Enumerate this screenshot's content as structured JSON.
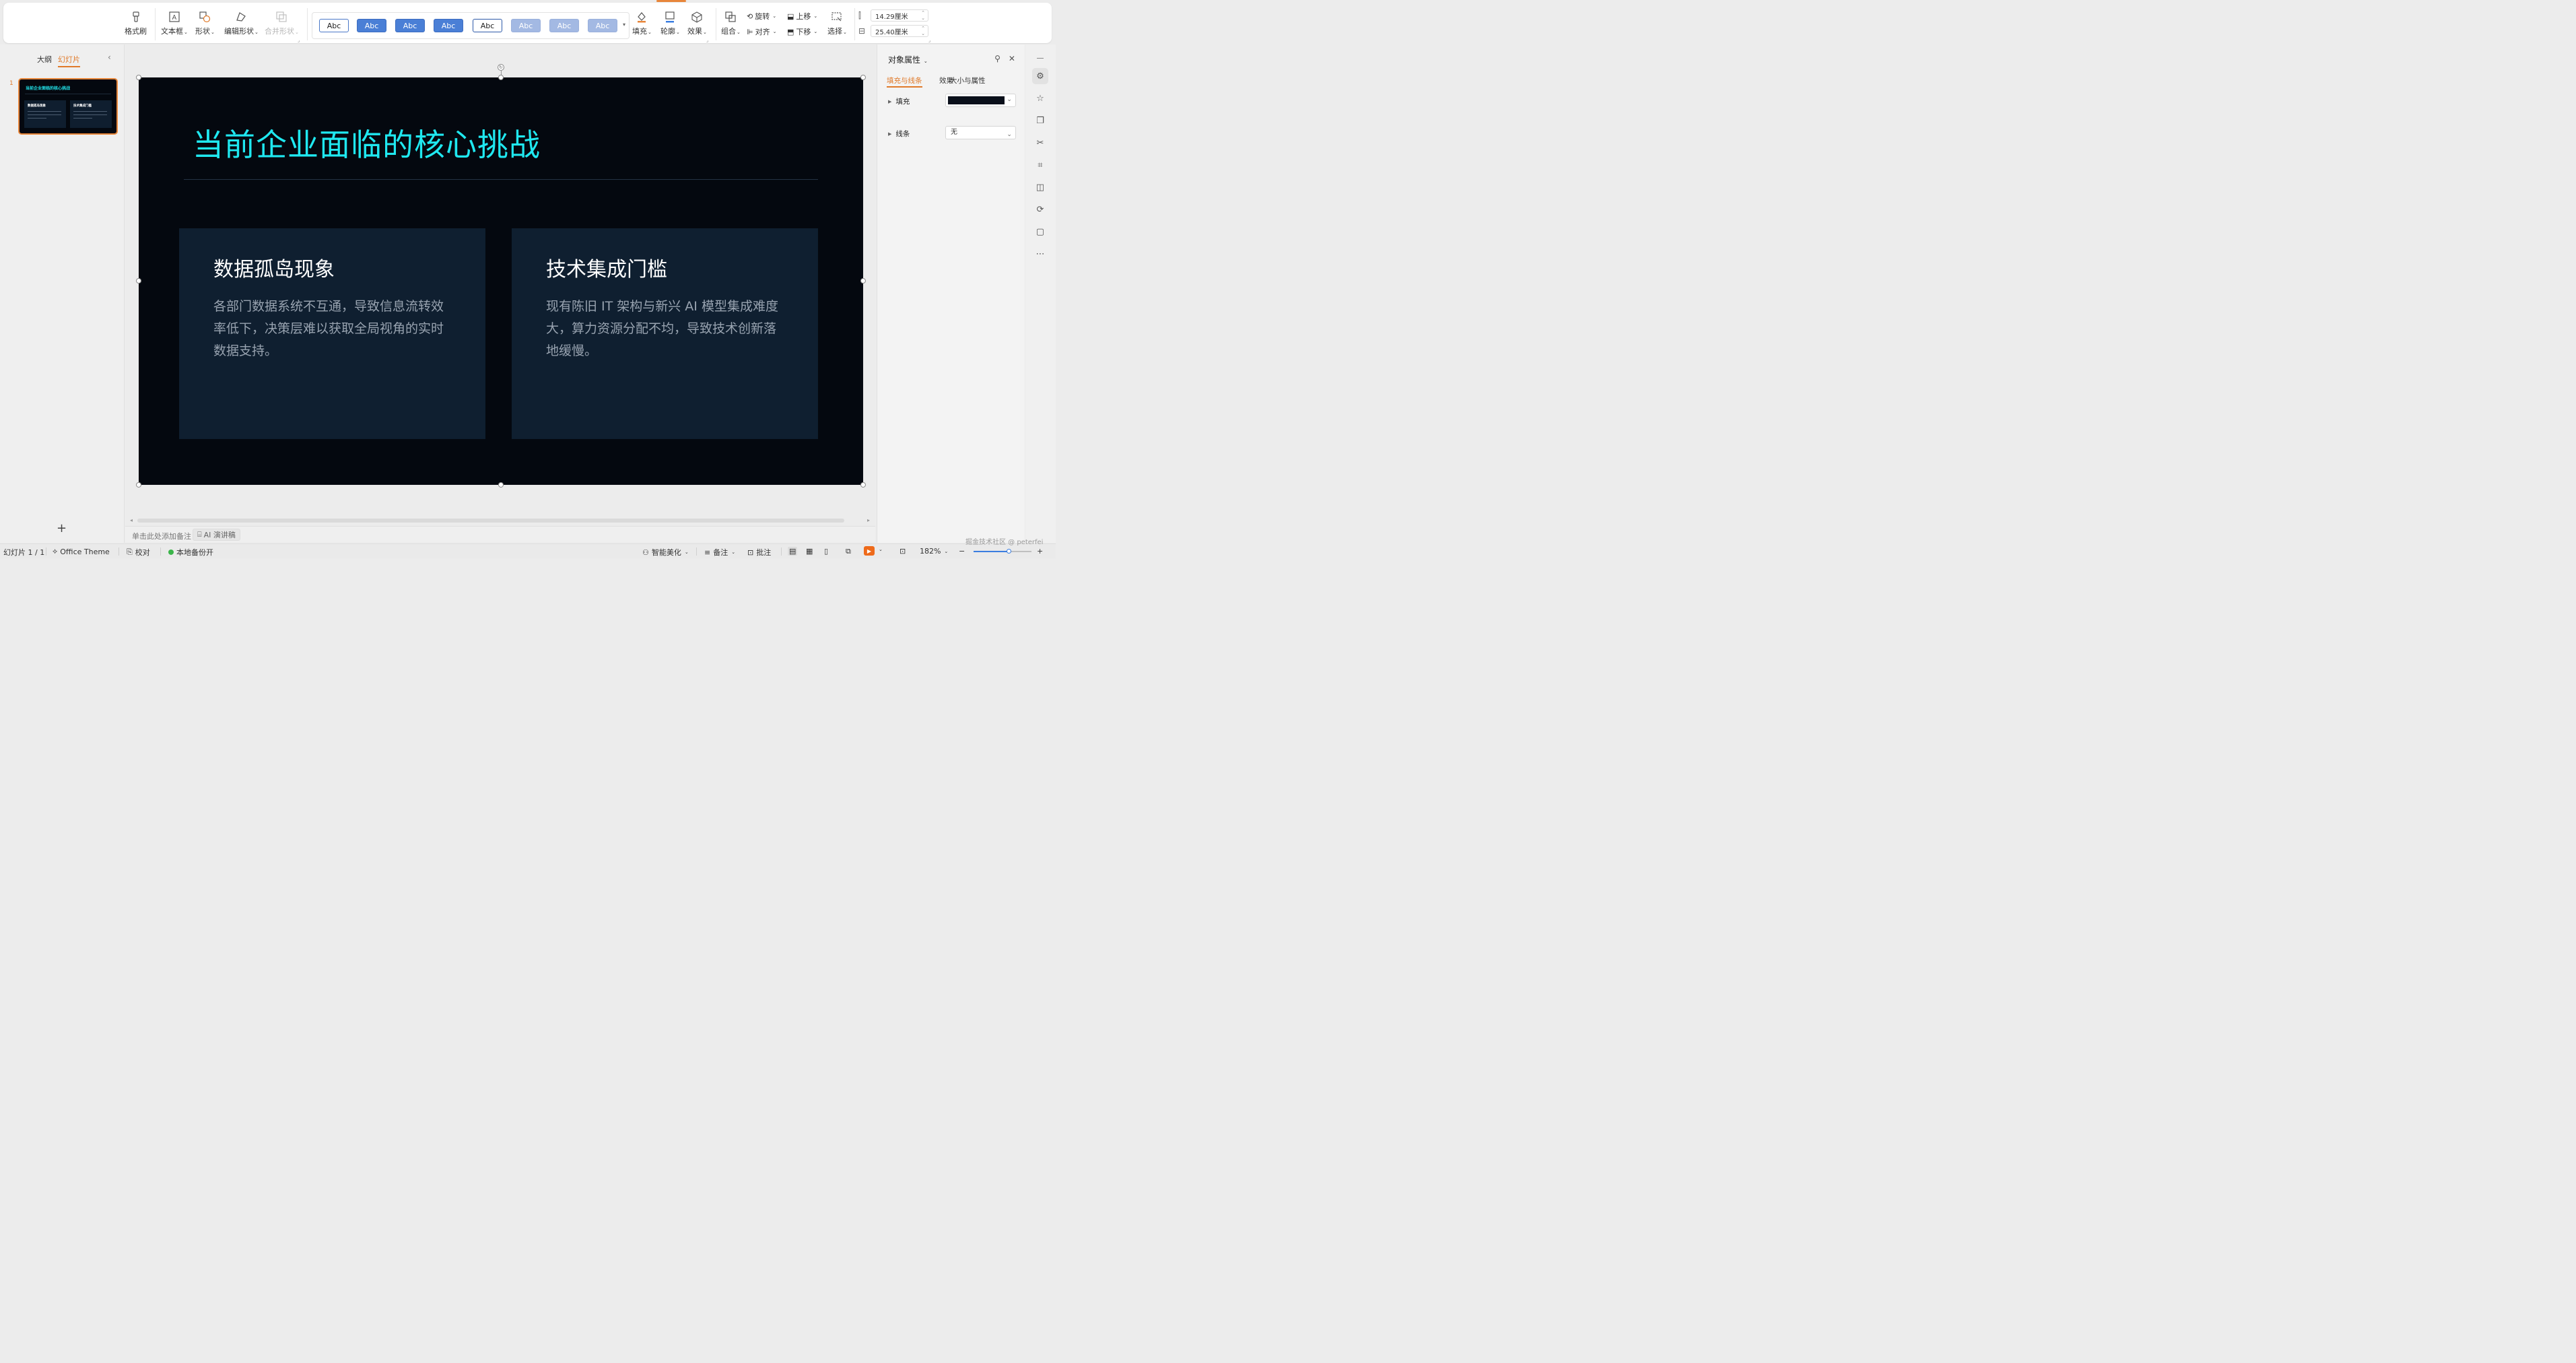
{
  "toolbar": {
    "format_painter": "格式刷",
    "text_box": "文本框",
    "shape": "形状",
    "edit_shape": "编辑形状",
    "merge_shape": "合并形状",
    "style_chips": [
      "Abc",
      "Abc",
      "Abc",
      "Abc",
      "Abc",
      "Abc",
      "Abc",
      "Abc"
    ],
    "fill": "填充",
    "outline": "轮廓",
    "effect": "效果",
    "group": "组合",
    "rotate": "旋转",
    "align": "对齐",
    "bring_forward": "上移",
    "send_backward": "下移",
    "select": "选择",
    "height_value": "14.29厘米",
    "width_value": "25.40厘米"
  },
  "left_panel": {
    "tab_outline": "大纲",
    "tab_slides": "幻灯片",
    "slide_number": "1"
  },
  "slide": {
    "title": "当前企业面临的核心挑战",
    "cards": [
      {
        "heading": "数据孤岛现象",
        "body": "各部门数据系统不互通，导致信息流转效率低下，决策层难以获取全局视角的实时数据支持。"
      },
      {
        "heading": "技术集成门槛",
        "body": "现有陈旧 IT 架构与新兴 AI 模型集成难度大，算力资源分配不均，导致技术创新落地缓慢。"
      }
    ]
  },
  "notes": {
    "placeholder": "单击此处添加备注",
    "ai_button": "AI 演讲稿"
  },
  "right_panel": {
    "title": "对象属性",
    "tabs": [
      "填充与线条",
      "效果",
      "大小与属性"
    ],
    "fill_label": "填充",
    "line_label": "线条",
    "line_value": "无",
    "fill_color": "#0a0f1a"
  },
  "status_bar": {
    "slide_indicator": "幻灯片 1 / 1",
    "theme": "Office Theme",
    "proofread": "校对",
    "backup": "本地备份开",
    "beautify": "智能美化",
    "notes": "备注",
    "comment": "批注",
    "zoom": "182%"
  },
  "watermark": "掘金技术社区 @ peterfei",
  "colors": {
    "accent": "#e8863a",
    "title_cyan": "#1fe8f0",
    "slide_bg": "#04080f",
    "card_bg": "#0f1f30"
  }
}
